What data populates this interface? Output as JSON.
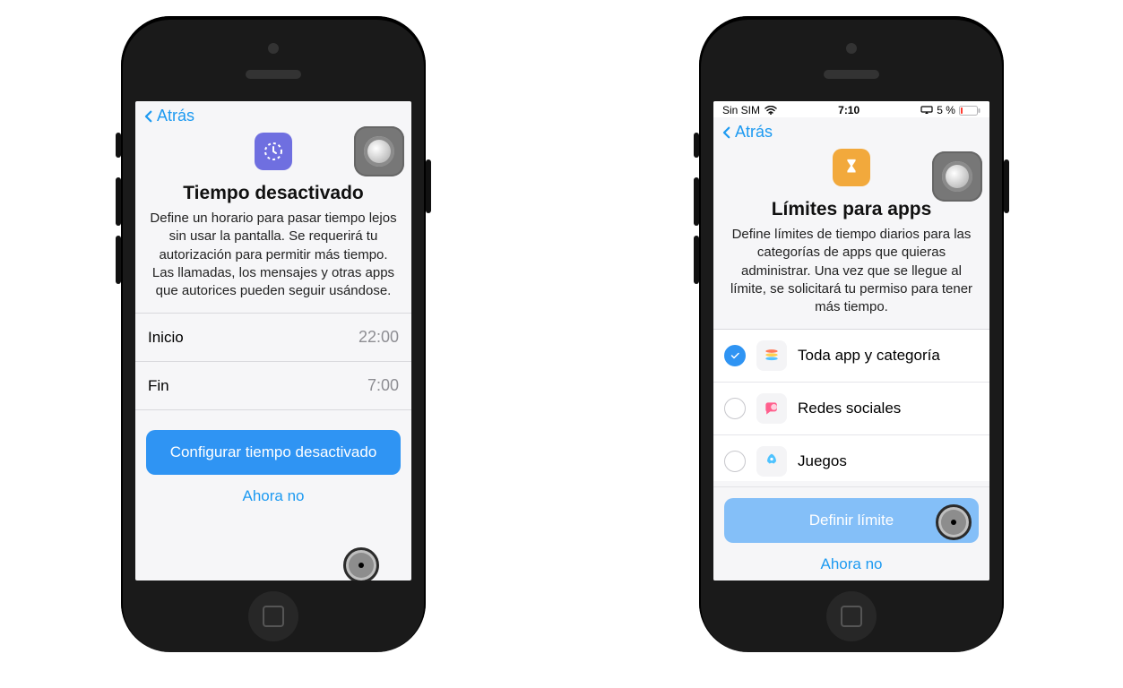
{
  "left": {
    "nav_back": "Atrás",
    "title": "Tiempo desactivado",
    "description": "Define un horario para pasar tiempo lejos sin usar la pantalla. Se requerirá tu autorización para permitir más tiempo. Las llamadas, los mensajes y otras apps que autorices pueden seguir usándose.",
    "rows": {
      "start_label": "Inicio",
      "start_value": "22:00",
      "end_label": "Fin",
      "end_value": "7:00"
    },
    "primary_button": "Configurar tiempo desactivado",
    "secondary_link": "Ahora no"
  },
  "right": {
    "status": {
      "carrier": "Sin SIM",
      "time": "7:10",
      "battery_text": "5 %"
    },
    "nav_back": "Atrás",
    "title": "Límites para apps",
    "description": "Define límites de tiempo diarios para las categorías de apps que quieras administrar. Una vez que se llegue al límite, se solicitará tu permiso para tener más tiempo.",
    "categories": {
      "c0_label": "Toda app y categoría",
      "c1_label": "Redes sociales",
      "c2_label": "Juegos"
    },
    "primary_button": "Definir límite",
    "secondary_link": "Ahora no"
  }
}
